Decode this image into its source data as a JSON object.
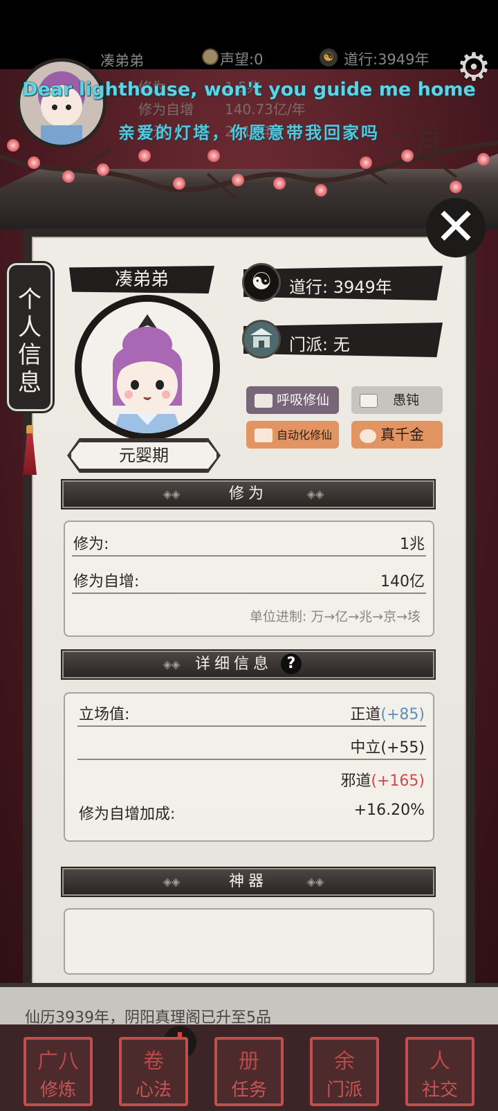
{
  "status": {
    "player_name": "凑弟弟",
    "prestige": "声望:0",
    "dao_years": "道行:3949年"
  },
  "background_info": {
    "lines": [
      {
        "label": "修为",
        "value": "1.5兆"
      },
      {
        "label": "修为自增",
        "value": "140.73亿/年"
      },
      {
        "label": "寿元",
        "value": "2415年"
      }
    ],
    "month_label": "二月"
  },
  "subtitles": {
    "en": "Dear lighthouse, won't you guide me home",
    "zh": "亲爱的灯塔，你愿意带我回家吗"
  },
  "side_tab": {
    "label": "个人信息"
  },
  "profile": {
    "name": "凑弟弟",
    "realm": "元婴期",
    "dao_line": "道行: 3949年",
    "sect_line": "门派: 无",
    "tags": [
      {
        "label": "呼吸修仙",
        "style": "purple"
      },
      {
        "label": "愚钝",
        "style": "gray"
      },
      {
        "label": "自动化修仙",
        "style": "orange"
      },
      {
        "label": "真千金",
        "style": "orange"
      }
    ]
  },
  "cultivation": {
    "header": "修为",
    "rows": [
      {
        "label": "修为:",
        "value": "1兆"
      },
      {
        "label": "修为自增:",
        "value": "140亿"
      }
    ],
    "unit_note": "单位进制: 万→亿→兆→京→垓"
  },
  "details": {
    "header": "详细信息",
    "help_icon": "?",
    "stance_label": "立场值:",
    "stances": [
      {
        "name": "正道",
        "bonus": "(+85)"
      },
      {
        "name": "中立",
        "bonus": "(+55)"
      },
      {
        "name": "邪道",
        "bonus": "(+165)"
      }
    ],
    "boost_label": "修为自增加成:",
    "boost_value": "+16.20%"
  },
  "artifact": {
    "header": "神器"
  },
  "log_text": "仙历3939年，阴阳真理阁已升至5品",
  "nav": [
    {
      "label": "修炼",
      "glyph": "广八"
    },
    {
      "label": "心法",
      "glyph": "卷"
    },
    {
      "label": "任务",
      "glyph": "册"
    },
    {
      "label": "门派",
      "glyph": "余"
    },
    {
      "label": "社交",
      "glyph": "人"
    }
  ],
  "colors": {
    "accent_blue": "#5f8fb2",
    "accent_red": "#d0484b",
    "subtitle_cyan": "#5fd3e4",
    "nav_red": "#c0504d"
  },
  "icons": [
    "settings-gear-icon",
    "close-x-icon",
    "yin-yang-icon",
    "sect-gate-icon",
    "scroll-icon",
    "money-bag-icon",
    "help-question-icon",
    "alert-exclamation-icon"
  ]
}
